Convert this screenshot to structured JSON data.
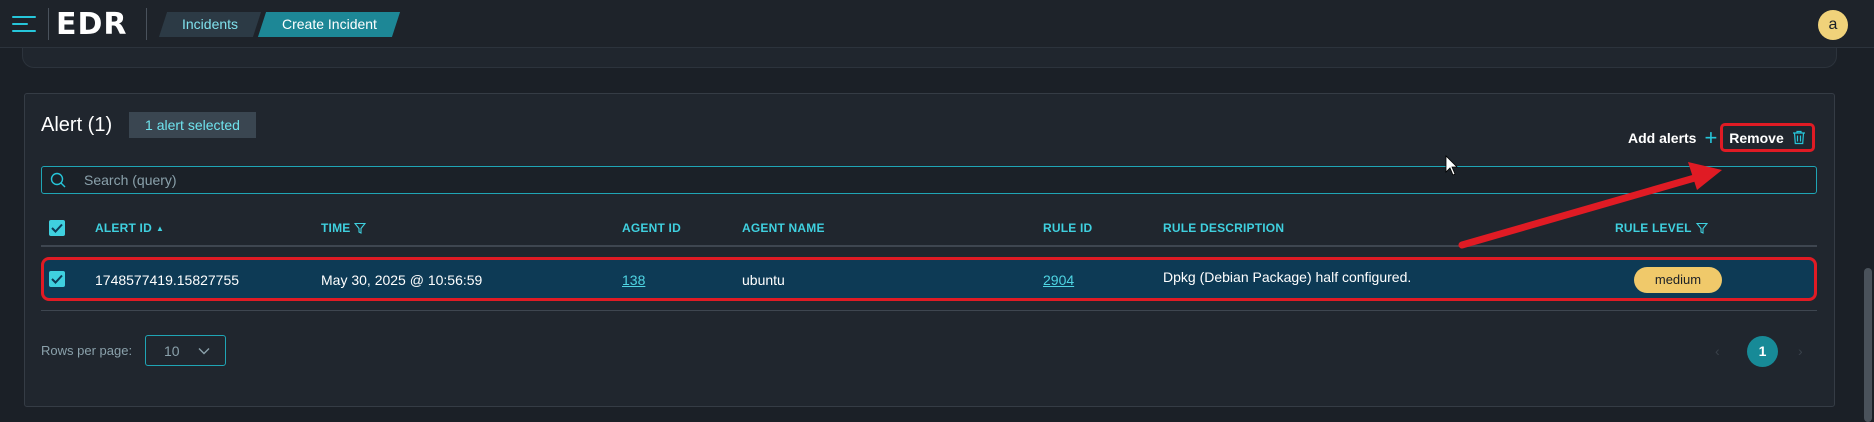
{
  "app": {
    "logo": "EDR",
    "avatar_initial": "a"
  },
  "breadcrumbs": [
    "Incidents",
    "Create Incident"
  ],
  "alerts": {
    "title": "Alert (1)",
    "selected_badge": "1 alert selected",
    "add_label": "Add alerts",
    "remove_label": "Remove",
    "search_placeholder": "Search (query)",
    "columns": [
      "ALERT ID",
      "TIME",
      "AGENT ID",
      "AGENT NAME",
      "RULE ID",
      "RULE DESCRIPTION",
      "RULE LEVEL"
    ],
    "rows": [
      {
        "alert_id": "1748577419.15827755",
        "time": "May 30, 2025 @ 10:56:59",
        "agent_id": "138",
        "agent_name": "ubuntu",
        "rule_id": "2904",
        "rule_description": "Dpkg (Debian Package) half configured.",
        "rule_level": "medium"
      }
    ],
    "rows_per_page_label": "Rows per page:",
    "rows_per_page_value": "10",
    "current_page": "1"
  },
  "icons": {
    "menu": "hamburger-menu-icon",
    "add": "plus-icon",
    "remove": "trash-icon",
    "search": "search-icon",
    "sort": "sort-ascending-icon",
    "filter": "filter-icon",
    "dropdown": "chevron-down-icon"
  },
  "colors": {
    "accent": "#26c6da",
    "highlight": "#e01b24",
    "selected_row": "#0d3a55",
    "level_medium": "#f0c96a"
  }
}
